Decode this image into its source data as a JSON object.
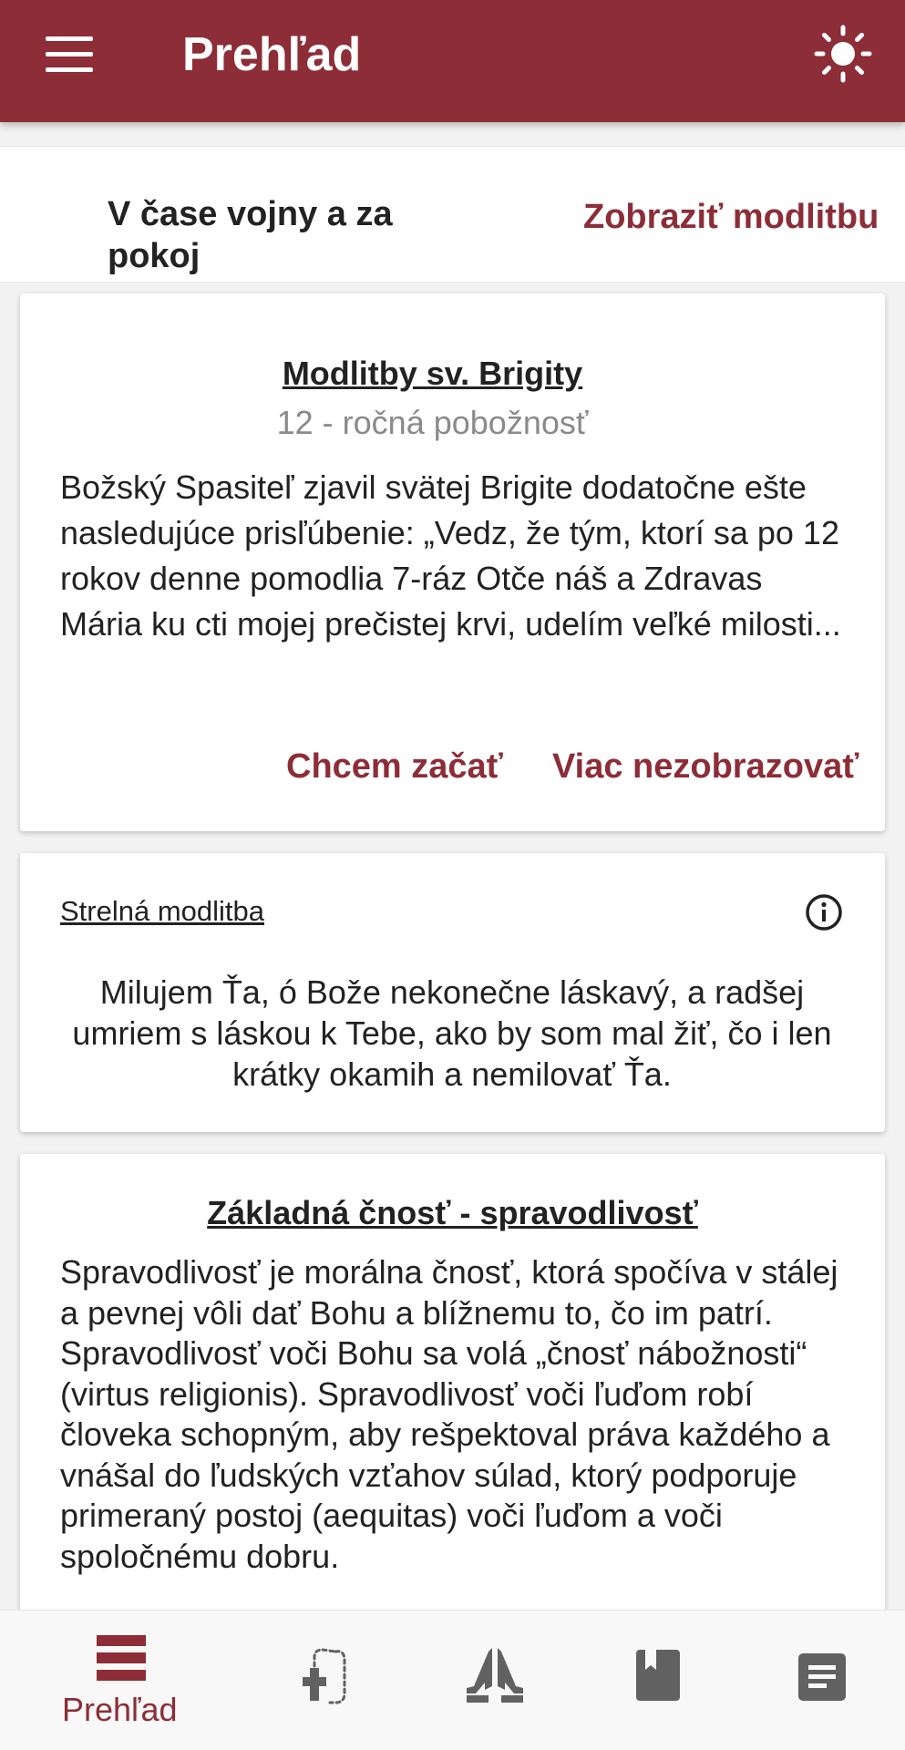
{
  "appbar": {
    "title": "Prehľad",
    "menu_icon": "menu-icon",
    "theme_icon": "brightness-icon",
    "color": "#8c2d37"
  },
  "intention": {
    "title": "V čase vojny a za pokoj",
    "link": "Zobraziť modlitbu"
  },
  "cards": {
    "brigita": {
      "title": "Modlitby sv. Brigity",
      "subtitle": "12 - ročná pobožnosť",
      "body": "Božský Spasiteľ zjavil svätej Brigite dodatočne ešte nasledujúce prisľúbenie: „Vedz, že tým, ktorí sa po 12 rokov denne pomodlia 7-ráz Otče náš a Zdravas Mária ku cti mojej prečistej krvi, udelím veľké milosti...",
      "action_start": "Chcem začať",
      "action_hide": "Viac nezobrazovať"
    },
    "ejaculation": {
      "label": "Strelná modlitba",
      "info_icon": "info-icon",
      "body": "Milujem Ťa, ó Bože nekonečne láskavý, a radšej umriem s láskou k Tebe, ako by som mal žiť, čo i len krátky okamih a nemilovať Ťa."
    },
    "virtue": {
      "title": "Základná čnosť - spravodlivosť",
      "body": "Spravodlivosť je morálna čnosť, ktorá spočíva v stálej a pevnej vôli dať Bohu a blížnemu to, čo im patrí. Spravodlivosť voči Bohu sa volá „čnosť nábožnosti“ (virtus religionis). Spravodlivosť voči ľuďom robí človeka schopným, aby rešpektoval práva každého a vnášal do ľudských vzťahov súlad, ktorý podporuje primeraný postoj (aequitas) voči ľuďom a voči spoločnému dobru."
    }
  },
  "bottom_nav": {
    "items": [
      {
        "label": "Prehľad",
        "icon": "overview-icon",
        "active": true
      },
      {
        "icon": "rosary-icon"
      },
      {
        "icon": "praying-hands-icon"
      },
      {
        "icon": "bookmark-book-icon"
      },
      {
        "icon": "document-icon"
      }
    ],
    "active_color": "#8c2d37",
    "inactive_color": "#616161"
  }
}
